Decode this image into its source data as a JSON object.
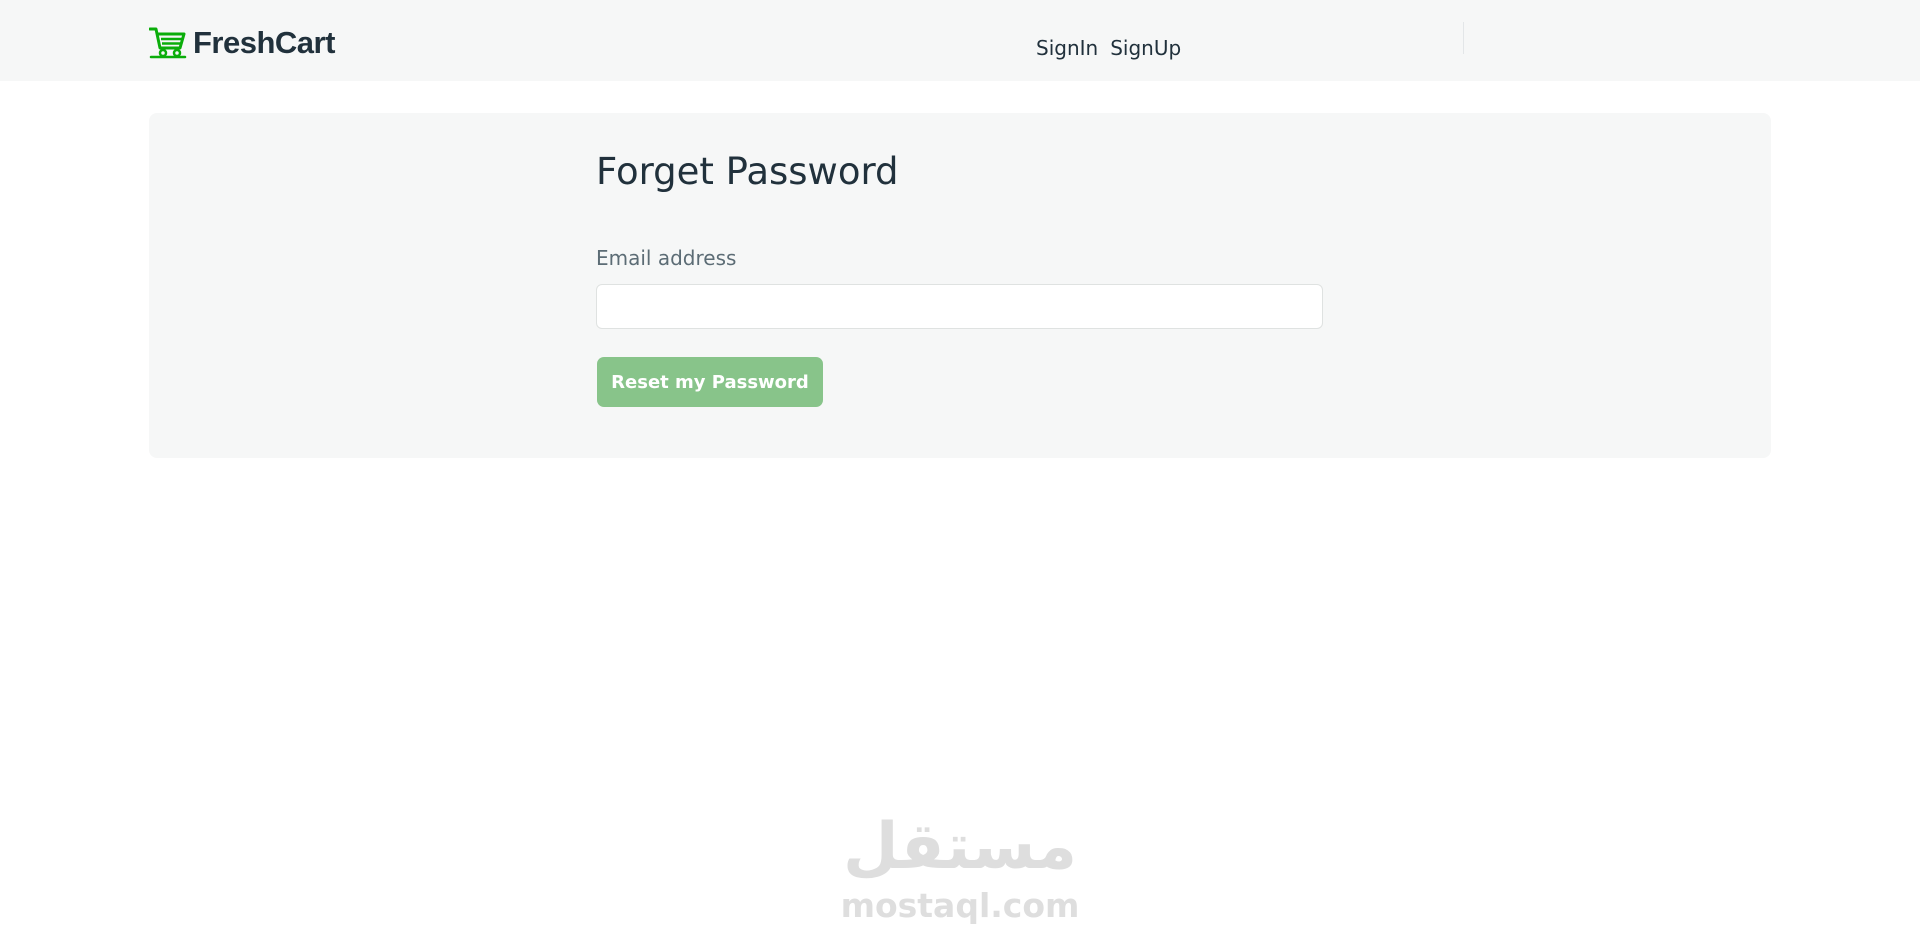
{
  "navbar": {
    "brand": {
      "icon": "cart-icon",
      "name": "FreshCart",
      "color": "#0aad0a"
    },
    "links": [
      {
        "label": "SignIn"
      },
      {
        "label": "SignUp"
      }
    ]
  },
  "form": {
    "title": "Forget Password",
    "email_label": "Email address",
    "email_value": "",
    "email_placeholder": "",
    "submit_label": "Reset my Password"
  },
  "watermark": {
    "arabic": "مستقل",
    "latin": "mostaql.com"
  },
  "colors": {
    "navbar_bg": "#f6f7f7",
    "panel_bg": "#f6f7f7",
    "button_bg": "#88c48a",
    "text": "#21313c",
    "brand_accent": "#0aad0a"
  }
}
